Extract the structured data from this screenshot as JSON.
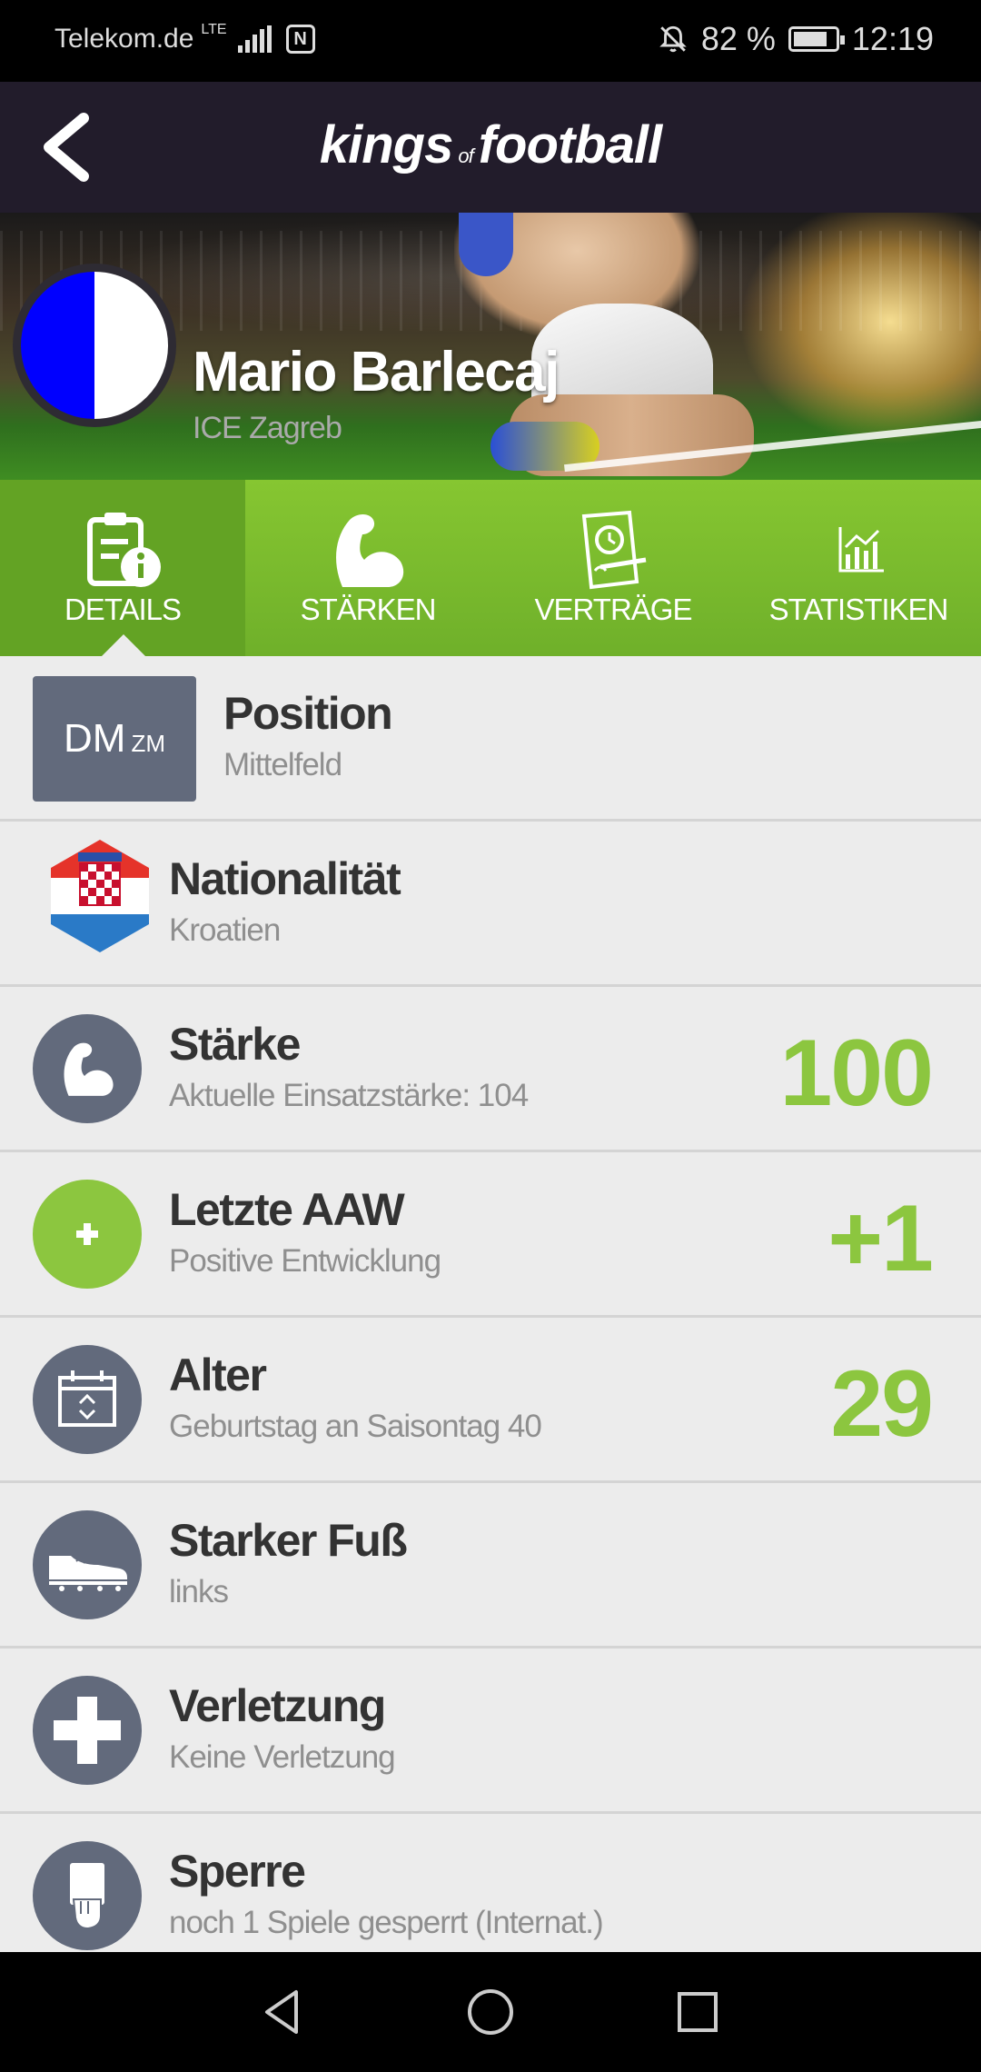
{
  "status_bar": {
    "carrier": "Telekom.de",
    "network": "LTE",
    "battery": "82 %",
    "battery_level": 0.82,
    "time": "12:19"
  },
  "app_bar": {
    "logo_part1": "kings",
    "logo_part2": "of",
    "logo_part3": "football",
    "back_icon": "chevron-left-icon"
  },
  "player": {
    "name": "Mario Barlecaj",
    "club": "ICE Zagreb",
    "club_colors": [
      "#0000ff",
      "#ffffff"
    ]
  },
  "tabs": [
    {
      "label": "DETAILS",
      "icon": "clipboard-info-icon",
      "active": true
    },
    {
      "label": "STÄRKEN",
      "icon": "bicep-icon",
      "active": false
    },
    {
      "label": "VERTRÄGE",
      "icon": "contract-clock-icon",
      "active": false
    },
    {
      "label": "STATISTIKEN",
      "icon": "bar-chart-icon",
      "active": false
    }
  ],
  "details": {
    "position": {
      "box_main": "DM",
      "box_small": "ZM",
      "title": "Position",
      "sub": "Mittelfeld"
    },
    "nationality": {
      "title": "Nationalität",
      "sub": "Kroatien",
      "icon": "croatia-flag-icon"
    },
    "strength": {
      "title": "Stärke",
      "sub": "Aktuelle Einsatzstärke: 104",
      "value": "100",
      "icon": "bicep-icon"
    },
    "last_aaw": {
      "title": "Letzte AAW",
      "sub": "Positive Entwicklung",
      "value": "+1",
      "icon": "plus-icon"
    },
    "age": {
      "title": "Alter",
      "sub": "Geburtstag an Saisontag 40",
      "value": "29",
      "icon": "calendar-icon"
    },
    "foot": {
      "title": "Starker Fuß",
      "sub": "links",
      "icon": "shoe-icon"
    },
    "injury": {
      "title": "Verletzung",
      "sub": "Keine Verletzung",
      "icon": "medical-cross-icon"
    },
    "suspension": {
      "title": "Sperre",
      "sub": "noch 1 Spiele gesperrt (Internat.)",
      "icon": "red-card-hand-icon"
    }
  },
  "colors": {
    "accent_green": "#8cc63f",
    "icon_gray": "#626a7c",
    "app_bar": "#221c2b"
  }
}
